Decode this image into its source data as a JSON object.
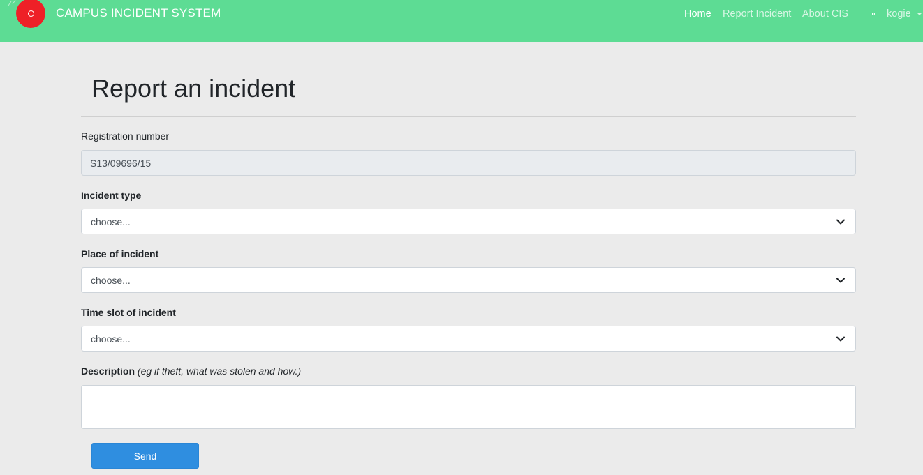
{
  "navbar": {
    "brand": "CAMPUS INCIDENT SYSTEM",
    "links": [
      {
        "label": "Home",
        "active": true
      },
      {
        "label": "Report Incident",
        "active": false
      },
      {
        "label": "About CIS",
        "active": false
      }
    ],
    "user": "kogie",
    "colors": {
      "background": "#5ddc94",
      "logo": "#ee2027"
    }
  },
  "page": {
    "title": "Report an incident"
  },
  "form": {
    "registration": {
      "label": "Registration number",
      "value": "S13/09696/15"
    },
    "incident_type": {
      "label": "Incident type",
      "selected": "choose..."
    },
    "place": {
      "label": "Place of incident",
      "selected": "choose..."
    },
    "time_slot": {
      "label": "Time slot of incident",
      "selected": "choose..."
    },
    "description": {
      "label": "Description",
      "hint": "(eg if theft, what was stolen and how.)",
      "value": ""
    },
    "submit_label": "Send",
    "colors": {
      "button": "#2f8ee0"
    }
  }
}
